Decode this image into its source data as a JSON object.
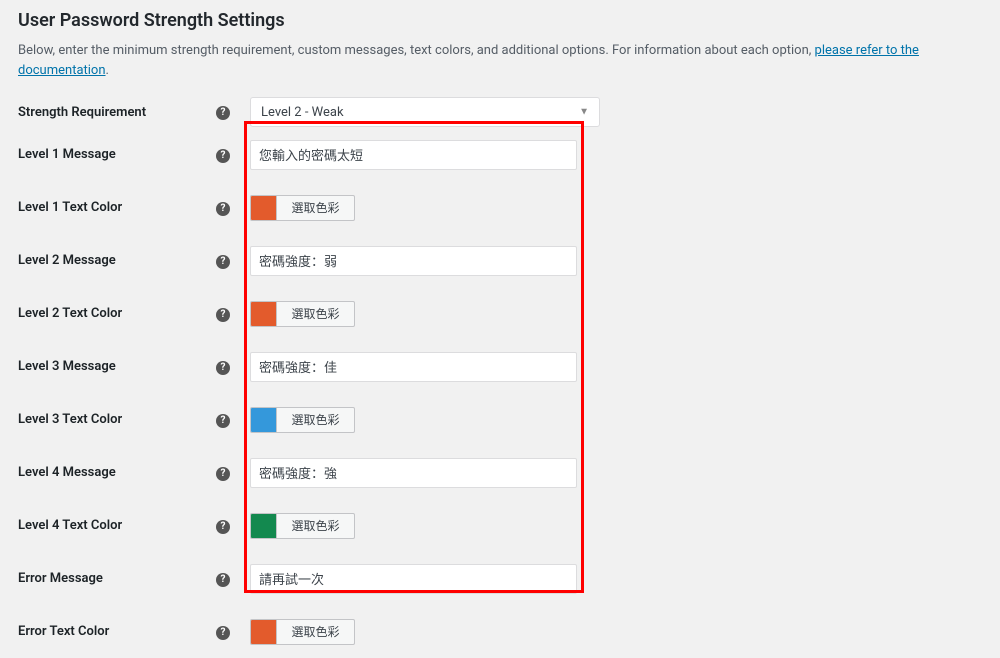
{
  "section": {
    "title": "User Password Strength Settings",
    "description_pre": "Below, enter the minimum strength requirement, custom messages, text colors, and additional options. For information about each option, ",
    "description_link": "please refer to the documentation",
    "description_post": "."
  },
  "help_glyph": "?",
  "color_button_label": "選取色彩",
  "rows": {
    "strength_req": {
      "label": "Strength Requirement",
      "value": "Level 2 - Weak"
    },
    "l1_msg": {
      "label": "Level 1 Message",
      "value": "您輸入的密碼太短"
    },
    "l1_color": {
      "label": "Level 1 Text Color",
      "swatch": "#e35b2c"
    },
    "l2_msg": {
      "label": "Level 2 Message",
      "value": "密碼強度：弱"
    },
    "l2_color": {
      "label": "Level 2 Text Color",
      "swatch": "#e35b2c"
    },
    "l3_msg": {
      "label": "Level 3 Message",
      "value": "密碼強度：佳"
    },
    "l3_color": {
      "label": "Level 3 Text Color",
      "swatch": "#3498db"
    },
    "l4_msg": {
      "label": "Level 4 Message",
      "value": "密碼強度：強"
    },
    "l4_color": {
      "label": "Level 4 Text Color",
      "swatch": "#13894f"
    },
    "err_msg": {
      "label": "Error Message",
      "value": "請再試一次"
    },
    "err_color": {
      "label": "Error Text Color",
      "swatch": "#e35b2c"
    }
  }
}
